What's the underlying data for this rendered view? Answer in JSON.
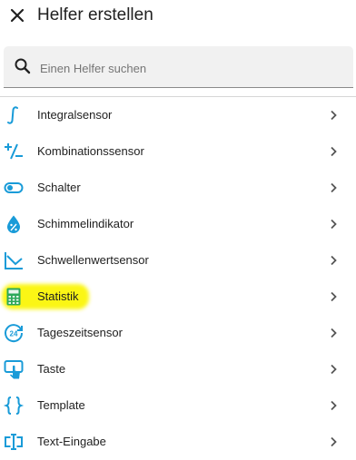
{
  "dialog": {
    "title": "Helfer erstellen"
  },
  "search": {
    "placeholder": "Einen Helfer suchen",
    "value": ""
  },
  "items": [
    {
      "label": "Integralsensor",
      "icon": "integral-icon"
    },
    {
      "label": "Kombinationssensor",
      "icon": "plus-minus-icon"
    },
    {
      "label": "Schalter",
      "icon": "toggle-switch-icon"
    },
    {
      "label": "Schimmelindikator",
      "icon": "water-percent-icon"
    },
    {
      "label": "Schwellenwertsensor",
      "icon": "threshold-chart-icon"
    },
    {
      "label": "Statistik",
      "icon": "calculator-icon",
      "highlighted": true
    },
    {
      "label": "Tageszeitsensor",
      "icon": "clock-24h-icon"
    },
    {
      "label": "Taste",
      "icon": "gesture-tap-button-icon"
    },
    {
      "label": "Template",
      "icon": "code-braces-icon"
    },
    {
      "label": "Text-Eingabe",
      "icon": "form-textbox-icon"
    }
  ],
  "colors": {
    "icon": "#199bd8",
    "text": "#212121",
    "highlight": "#fbf615",
    "search_bg": "#f1f1f1"
  }
}
